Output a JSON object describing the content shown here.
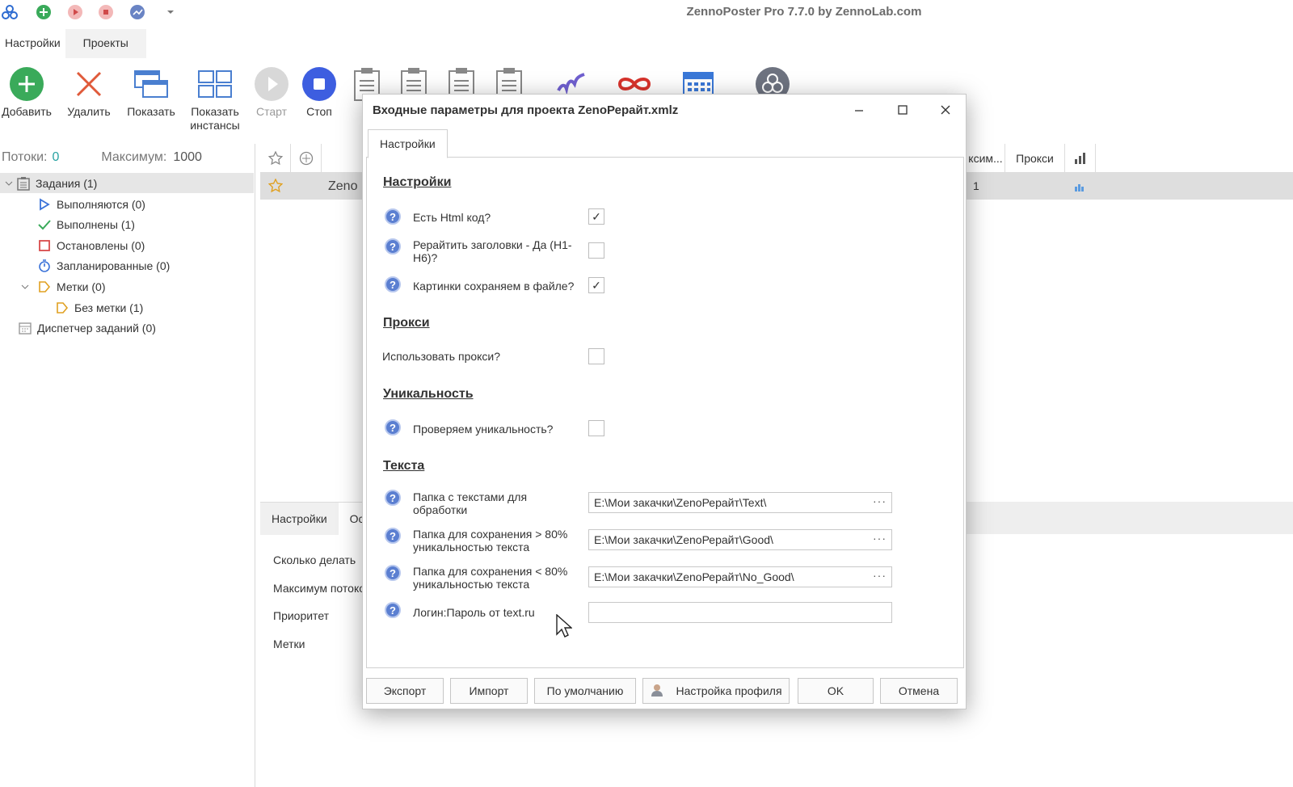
{
  "app": {
    "title": "ZennoPoster Pro 7.7.0 by ZennoLab.com"
  },
  "ribbon_tabs": [
    "Настройки",
    "Проекты"
  ],
  "ribbon": {
    "add": "Добавить",
    "delete": "Удалить",
    "show": "Показать",
    "show_instances_1": "Показать",
    "show_instances_2": "инстансы",
    "start": "Старт",
    "stop": "Стоп"
  },
  "left_panel": {
    "threads_label": "Потоки:",
    "threads_value": "0",
    "max_label": "Максимум:",
    "max_value": "1000",
    "tree": {
      "tasks": "Задания (1)",
      "running": "Выполняются (0)",
      "done": "Выполнены (1)",
      "stopped": "Остановлены (0)",
      "scheduled": "Запланированные (0)",
      "labels": "Метки (0)",
      "no_label": "Без метки (1)",
      "task_manager": "Диспетчер заданий (0)"
    }
  },
  "grid": {
    "col_max": "ксим...",
    "col_proxy": "Прокси",
    "row_name": "Zeno",
    "row_value": "1"
  },
  "bottom": {
    "tab_settings": "Настройки",
    "tab_other": "Ос",
    "fields": [
      "Сколько делать",
      "Максимум потоко",
      "Приоритет",
      "Метки"
    ]
  },
  "dialog": {
    "title": "Входные параметры для проекта ZenoРерайт.xmlz",
    "tab": "Настройки",
    "sections": {
      "settings": "Настройки",
      "proxy": "Прокси",
      "uniqueness": "Уникальность",
      "texts": "Текста"
    },
    "fields": {
      "html_code": "Есть Html код?",
      "rewrite_headers": "Рерайтить заголовки - Да (H1-H6)?",
      "save_images": "Картинки сохраняем в файле?",
      "use_proxy": "Использовать прокси?",
      "check_unique": "Проверяем уникальность?",
      "texts_folder": "Папка с текстами для обработки",
      "good_folder": "Папка для сохранения > 80% уникальностью текста",
      "bad_folder": "Папка для сохранения < 80% уникальностью текста",
      "login": "Логин:Пароль от text.ru"
    },
    "checks": {
      "html_code": true,
      "rewrite_headers": false,
      "save_images": true,
      "use_proxy": false,
      "check_unique": false
    },
    "values": {
      "texts_folder": "E:\\Мои закачки\\ZenoРерайт\\Text\\",
      "good_folder": "E:\\Мои закачки\\ZenoРерайт\\Good\\",
      "bad_folder": "E:\\Мои закачки\\ZenoРерайт\\No_Good\\",
      "login": ""
    },
    "browse": "···",
    "buttons": {
      "export": "Экспорт",
      "import": "Импорт",
      "defaults": "По умолчанию",
      "profile": "Настройка профиля",
      "ok": "OK",
      "cancel": "Отмена"
    }
  }
}
